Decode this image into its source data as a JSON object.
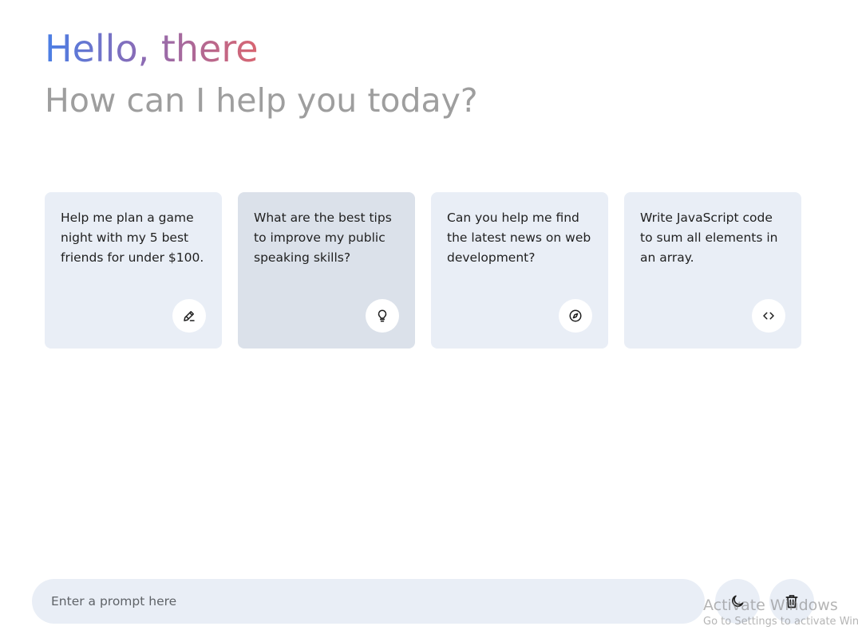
{
  "header": {
    "greeting": "Hello, there",
    "subtitle": "How can I help you today?"
  },
  "suggestions": [
    {
      "text": "Help me plan a game night with my 5 best friends for under $100.",
      "icon": "draw-icon"
    },
    {
      "text": "What are the best tips to improve my public speaking skills?",
      "icon": "lightbulb-icon"
    },
    {
      "text": "Can you help me find the latest news on web development?",
      "icon": "compass-icon"
    },
    {
      "text": "Write JavaScript code to sum all elements in an array.",
      "icon": "code-icon"
    }
  ],
  "prompt": {
    "placeholder": "Enter a prompt here",
    "value": ""
  },
  "buttons": {
    "theme_icon": "moon-icon",
    "delete_icon": "trash-icon"
  },
  "watermark": {
    "title": "Activate Windows",
    "subtitle": "Go to Settings to activate Windows."
  },
  "colors": {
    "gradient_start": "#4a7fe6",
    "gradient_end": "#d96570",
    "card_bg": "#e9eef6",
    "card_hover_bg": "#dbe1ea",
    "subtitle": "#9e9e9e"
  }
}
